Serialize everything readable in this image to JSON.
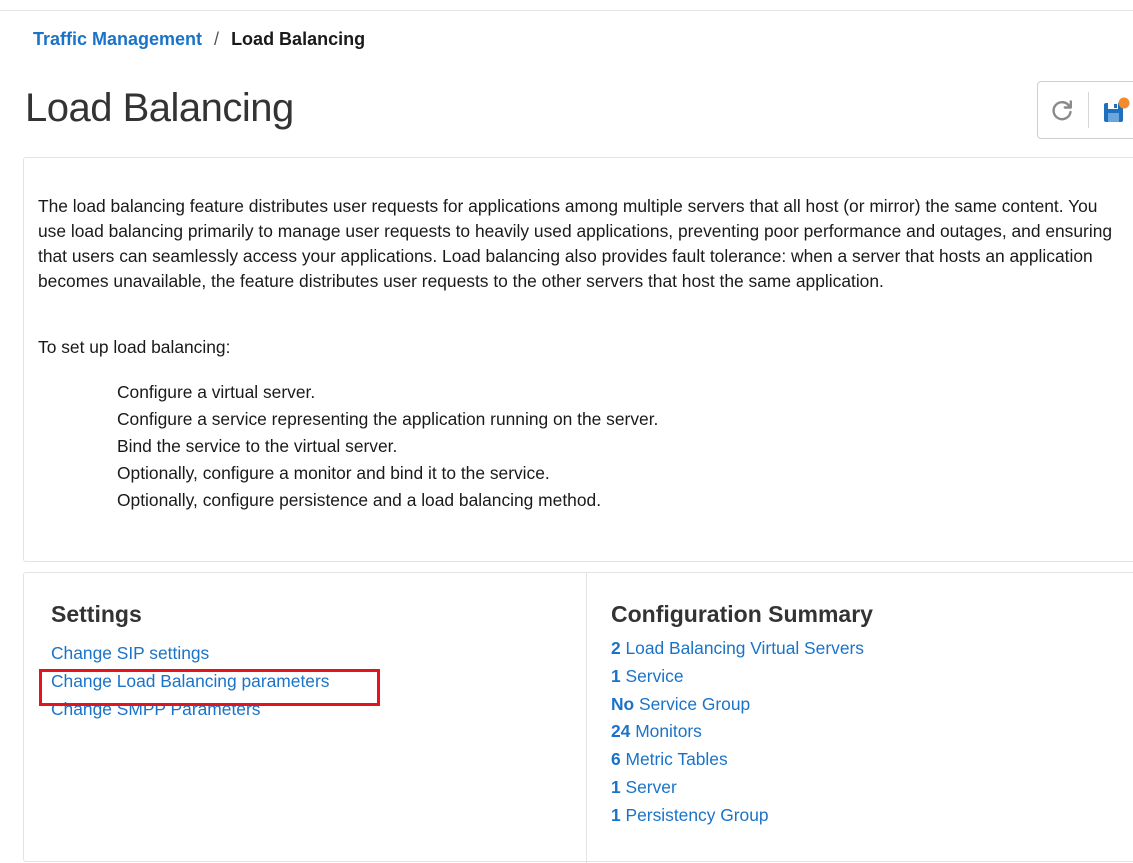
{
  "breadcrumb": {
    "parent": "Traffic Management",
    "separator": "/",
    "current": "Load Balancing"
  },
  "page": {
    "title": "Load Balancing"
  },
  "toolbar": {
    "refresh_icon": "refresh-icon",
    "save_icon": "save-config-icon",
    "save_badge_color": "#f28a2e"
  },
  "intro": {
    "description": "The load balancing feature distributes user requests for applications among multiple servers that all host (or mirror) the same content. You use load balancing primarily to manage user requests to heavily used applications, preventing poor performance and outages, and ensuring that users can seamlessly access your applications. Load balancing also provides fault tolerance: when a server that hosts an application becomes unavailable, the feature distributes user requests to the other servers that host the same application.",
    "steps_heading": "To set up load balancing:",
    "steps": [
      "Configure a virtual server.",
      "Configure a service representing the application running on the server.",
      "Bind the service to the virtual server.",
      "Optionally, configure a monitor and bind it to the service.",
      "Optionally, configure persistence and a load balancing method."
    ]
  },
  "settings": {
    "title": "Settings",
    "links": [
      "Change SIP settings",
      "Change Load Balancing parameters",
      "Change SMPP Parameters"
    ],
    "highlight_color": "#e3141b"
  },
  "summary": {
    "title": "Configuration Summary",
    "items": [
      {
        "count": "2",
        "label": "Load Balancing Virtual Servers"
      },
      {
        "count": "1",
        "label": "Service"
      },
      {
        "count": "No",
        "label": "Service Group"
      },
      {
        "count": "24",
        "label": "Monitors"
      },
      {
        "count": "6",
        "label": "Metric Tables"
      },
      {
        "count": "1",
        "label": "Server"
      },
      {
        "count": "1",
        "label": "Persistency Group"
      }
    ]
  },
  "colors": {
    "link": "#1a73c8",
    "text": "#1a1a1a",
    "border": "#e3e3e3"
  }
}
